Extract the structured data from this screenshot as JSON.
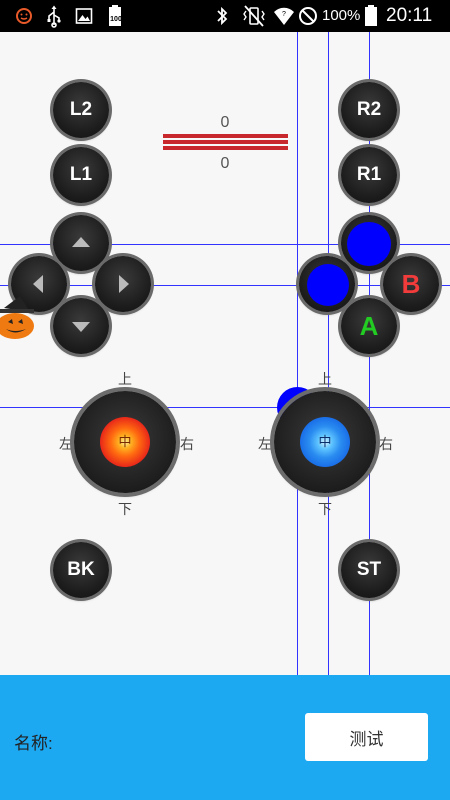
{
  "status_bar": {
    "battery_label": "100",
    "battery_percent": "100%",
    "time": "20:11",
    "icons": [
      "emoji-icon",
      "usb-icon",
      "image-icon",
      "battery-small-icon",
      "bluetooth-icon",
      "vibrate-icon",
      "wifi-icon",
      "do-not-disturb-icon",
      "battery-icon"
    ]
  },
  "buttons": {
    "l2": "L2",
    "l1": "L1",
    "r2": "R2",
    "r1": "R1",
    "b": "B",
    "a": "A",
    "bk": "BK",
    "st": "ST"
  },
  "trigger_bar": {
    "top_value": "0",
    "bottom_value": "0"
  },
  "left_stick": {
    "up": "上",
    "down": "下",
    "left": "左",
    "right": "右",
    "center": "中",
    "knob_color": "#e8281a"
  },
  "right_stick": {
    "up": "上",
    "down": "下",
    "left": "左",
    "right": "右",
    "center": "中",
    "knob_color": "#1a6fe8"
  },
  "colors": {
    "b_label": "#f23b3b",
    "a_label": "#22cc22",
    "touch_dot": "#0000ff",
    "bottom_bar": "#1da8f2",
    "guide_line": "#3333ff"
  },
  "footer": {
    "name_label": "名称:",
    "test_button": "测试"
  }
}
